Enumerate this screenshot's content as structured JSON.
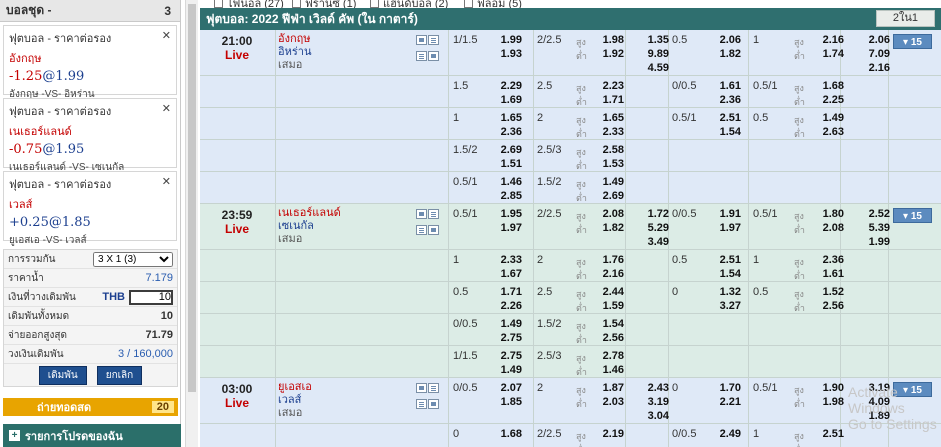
{
  "slip": {
    "title": "บอลชุด -",
    "count": "3",
    "items": [
      {
        "type": "ฟุตบอล - ราคาต่อรอง",
        "team": "อังกฤษ",
        "line": "-1.25",
        "at": "@",
        "odds": "1.99",
        "match": "อังกฤษ -VS- อิหร่าน"
      },
      {
        "type": "ฟุตบอล - ราคาต่อรอง",
        "team": "เนเธอร์แลนด์",
        "line": "-0.75",
        "at": "@",
        "odds": "1.95",
        "match": "เนเธอร์แลนด์ -VS- เซเนกัล"
      },
      {
        "type": "ฟุตบอล - ราคาต่อรอง",
        "team": "เวลส์",
        "line": "+0.25",
        "at": "@",
        "odds": "1.85",
        "match": "ยูเอสเอ -VS- เวลส์"
      }
    ],
    "close_glyph": "✕",
    "form": {
      "combo_label": "การรวมกัน",
      "combo_value": "3 X 1 (3)",
      "price_label": "ราคาน้ำ",
      "price_value": "7.179",
      "stake_label": "เงินที่วางเดิมพัน",
      "currency": "THB",
      "stake_value": "10",
      "total_label": "เดิมพันทั้งหมด",
      "total_value": "10",
      "payout_label": "จ่ายออกสูงสุด",
      "payout_value": "71.79",
      "limit_label": "วงเงินเดิมพัน",
      "limit_value": "3 / 160,000",
      "bet_button": "เดิมพัน",
      "cancel_button": "ยกเลิก"
    },
    "hot_label": "ถ่ายทอดสด",
    "hot_count": "20",
    "promo_label": "รายการโปรดของฉัน",
    "promo_plus": "+"
  },
  "filters": [
    {
      "label": "ไฟนอล (27)"
    },
    {
      "label": "ฟรานซ์ (1)"
    },
    {
      "label": "แฮนด์บอล (2)"
    },
    {
      "label": "ฟลอม (5)"
    }
  ],
  "league": {
    "title": "ฟุตบอล: 2022 ฟีฟ่า เวิลด์ คัพ (ใน กาตาร์)",
    "view_toggle": "2ใน1"
  },
  "labels": {
    "over": "สูง",
    "under": "ต่ำ"
  },
  "matches": [
    {
      "time": "21:00",
      "status": "Live",
      "home": "อังกฤษ",
      "away": "อิหร่าน",
      "draw": "เสมอ",
      "more": "▾ 15",
      "lines": [
        {
          "fh_hdp": "1/1.5",
          "fh_h": "1.99",
          "fh_a": "1.93",
          "fh_ou": "2/2.5",
          "fh_o": "1.98",
          "fh_u": "1.92",
          "x1": "1.35",
          "x2": "9.89",
          "x3": "4.59",
          "ht_hdp": "0.5",
          "ht_h": "2.06",
          "ht_a": "1.82",
          "ht_ou": "1",
          "ht_o": "2.16",
          "ht_u": "1.74",
          "hx1": "2.06",
          "hx2": "7.09",
          "hx3": "2.16"
        },
        {
          "fh_hdp": "1.5",
          "fh_h": "2.29",
          "fh_a": "1.69",
          "fh_ou": "2.5",
          "fh_o": "2.23",
          "fh_u": "1.71",
          "ht_hdp": "0/0.5",
          "ht_h": "1.61",
          "ht_a": "2.36",
          "ht_ou": "0.5/1",
          "ht_o": "1.68",
          "ht_u": "2.25"
        },
        {
          "fh_hdp": "1",
          "fh_h": "1.65",
          "fh_a": "2.36",
          "fh_ou": "2",
          "fh_o": "1.65",
          "fh_u": "2.33",
          "ht_hdp": "0.5/1",
          "ht_h": "2.51",
          "ht_a": "1.54",
          "ht_ou": "0.5",
          "ht_o": "1.49",
          "ht_u": "2.63"
        },
        {
          "fh_hdp": "1.5/2",
          "fh_h": "2.69",
          "fh_a": "1.51",
          "fh_ou": "2.5/3",
          "fh_o": "2.58",
          "fh_u": "1.53"
        },
        {
          "fh_hdp": "0.5/1",
          "fh_h": "1.46",
          "fh_a": "2.85",
          "fh_ou": "1.5/2",
          "fh_o": "1.49",
          "fh_u": "2.69"
        }
      ]
    },
    {
      "time": "23:59",
      "status": "Live",
      "home": "เนเธอร์แลนด์",
      "away": "เซเนกัล",
      "draw": "เสมอ",
      "more": "▾ 15",
      "lines": [
        {
          "fh_hdp": "0.5/1",
          "fh_h": "1.95",
          "fh_a": "1.97",
          "fh_ou": "2/2.5",
          "fh_o": "2.08",
          "fh_u": "1.82",
          "x1": "1.72",
          "x2": "5.29",
          "x3": "3.49",
          "ht_hdp": "0/0.5",
          "ht_h": "1.91",
          "ht_a": "1.97",
          "ht_ou": "0.5/1",
          "ht_o": "1.80",
          "ht_u": "2.08",
          "hx1": "2.52",
          "hx2": "5.39",
          "hx3": "1.99"
        },
        {
          "fh_hdp": "1",
          "fh_h": "2.33",
          "fh_a": "1.67",
          "fh_ou": "2",
          "fh_o": "1.76",
          "fh_u": "2.16",
          "ht_hdp": "0.5",
          "ht_h": "2.51",
          "ht_a": "1.54",
          "ht_ou": "1",
          "ht_o": "2.36",
          "ht_u": "1.61"
        },
        {
          "fh_hdp": "0.5",
          "fh_h": "1.71",
          "fh_a": "2.26",
          "fh_ou": "2.5",
          "fh_o": "2.44",
          "fh_u": "1.59",
          "ht_hdp": "0",
          "ht_h": "1.32",
          "ht_a": "3.27",
          "ht_ou": "0.5",
          "ht_o": "1.52",
          "ht_u": "2.56"
        },
        {
          "fh_hdp": "0/0.5",
          "fh_h": "1.49",
          "fh_a": "2.75",
          "fh_ou": "1.5/2",
          "fh_o": "1.54",
          "fh_u": "2.56"
        },
        {
          "fh_hdp": "1/1.5",
          "fh_h": "2.75",
          "fh_a": "1.49",
          "fh_ou": "2.5/3",
          "fh_o": "2.78",
          "fh_u": "1.46"
        }
      ]
    },
    {
      "time": "03:00",
      "status": "Live",
      "home": "ยูเอสเอ",
      "away": "เวลส์",
      "draw": "เสมอ",
      "more": "▾ 15",
      "lines": [
        {
          "fh_hdp": "0/0.5",
          "fh_h": "2.07",
          "fh_a": "1.85",
          "fh_ou": "2",
          "fh_o": "1.87",
          "fh_u": "2.03",
          "x1": "2.43",
          "x2": "3.19",
          "x3": "3.04",
          "ht_hdp": "0",
          "ht_h": "1.70",
          "ht_a": "2.21",
          "ht_ou": "0.5/1",
          "ht_o": "1.90",
          "ht_u": "1.98",
          "hx1": "3.19",
          "hx2": "4.09",
          "hx3": "1.89"
        },
        {
          "fh_hdp": "0",
          "fh_h": "1.68",
          "fh_a": "",
          "fh_ou": "2/2.5",
          "fh_o": "2.19",
          "fh_u": "",
          "ht_hdp": "0/0.5",
          "ht_h": "2.49",
          "ht_a": "",
          "ht_ou": "1",
          "ht_o": "2.51",
          "ht_u": ""
        }
      ]
    }
  ],
  "watermark": {
    "line1": "Activate Windows",
    "line2": "Go to Settings"
  },
  "colors": {
    "league_bar": "#2f6f6f",
    "main_row": "#dfe9f7",
    "alt_row": "#dcece6",
    "live": "#c40000",
    "hot_bar": "#e8a400"
  }
}
